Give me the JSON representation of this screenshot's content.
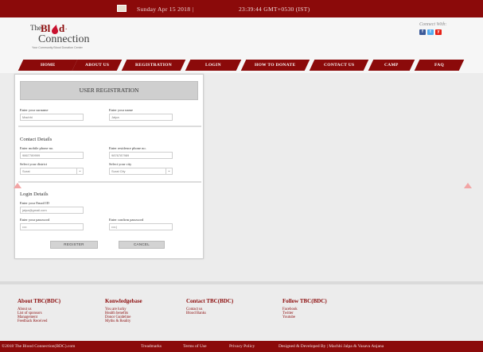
{
  "topbar": {
    "date": "Sunday Apr 15 2018 |",
    "time": "23:39:44  GMT+0530 (IST)"
  },
  "header": {
    "logo_top": "The",
    "logo_blood": "Blood",
    "logo_connection": "Connection",
    "logo_tagline": "Your Community Blood Donation Center",
    "connect_label": "Connect With:",
    "social": [
      "f",
      "t",
      "y"
    ]
  },
  "nav": {
    "items": [
      "HOME",
      "ABOUT US",
      "REGISTRATION",
      "LOGIN",
      "HOW TO DONATE",
      "CONTACT US",
      "CAMP",
      "FAQ"
    ]
  },
  "form": {
    "title": "USER REGISTRATION",
    "surname_label": "Enter your surname",
    "surname_value": "Machhi",
    "name_label": "Enter your name",
    "name_value": "Jalpa",
    "contact_title": "Contact Details",
    "mobile_label": "Enter mobile phone no.",
    "mobile_value": "9867789999",
    "residence_label": "Enter residence phone no.",
    "residence_value": "9876787989",
    "district_label": "Select your district",
    "district_value": "Surat",
    "city_label": "Select your city",
    "city_value": "Surat City",
    "login_title": "Login Details",
    "email_label": "Enter your Email ID",
    "email_value": "jalpa@gmail.com",
    "password_label": "Enter your password",
    "password_value": "••••",
    "confirm_label": "Enter confirm password",
    "confirm_value": "••••|",
    "register_label": "REGISTER",
    "cancel_label": "CANCEL"
  },
  "footer": {
    "about": {
      "heading": "About TBC(BDC)",
      "links": [
        "About us",
        "List of sponsors",
        "Management",
        "Feedback Received"
      ]
    },
    "knowledge": {
      "heading": "Konwledgebase",
      "links": [
        "You are lucky",
        "Health benefits",
        "Donor Guideline",
        "Myths & Reality"
      ]
    },
    "contact": {
      "heading": "Contact TBC(BDC)",
      "links": [
        "Contact us",
        "Blood Banks"
      ]
    },
    "follow": {
      "heading": "Follow TBC(BDC)",
      "links": [
        "Facebook",
        "Twitter",
        "Youtube"
      ]
    }
  },
  "bottombar": {
    "copyright": "©2018 The Blood Connection(BDC).com",
    "trademarks": "Treadmarks",
    "terms": "Terms of Use",
    "privacy": "Privacy Policy",
    "credit": "Designed & Developed By | Machhi Jalpa & Vasava Anjana"
  },
  "colors": {
    "brand": "#8b0a0a",
    "background": "#ececec",
    "button": "#d3d3d3"
  }
}
